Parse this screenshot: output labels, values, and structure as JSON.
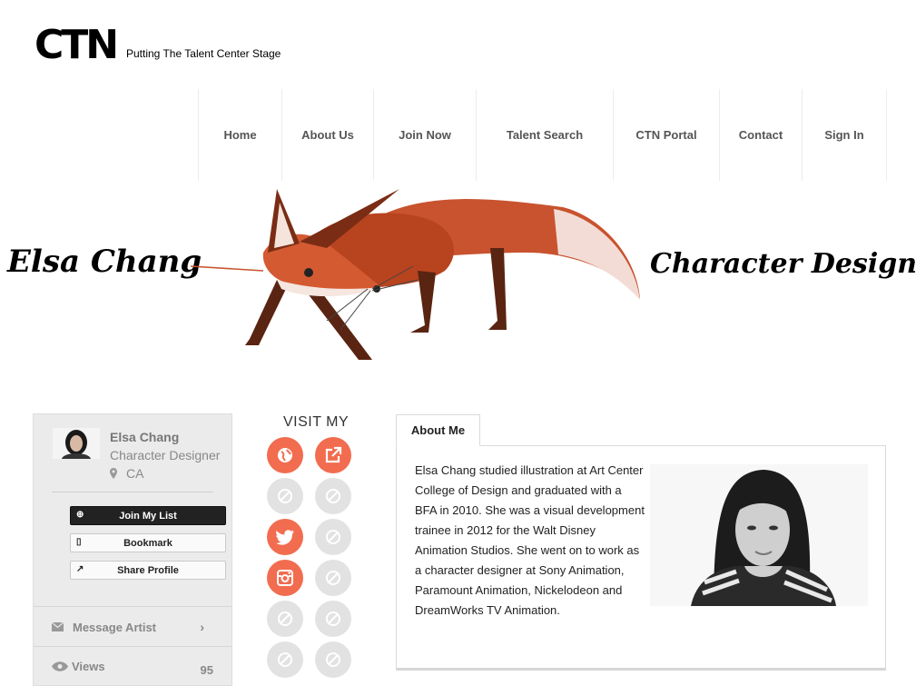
{
  "header": {
    "logo": "CTN",
    "tagline": "Putting The Talent Center Stage"
  },
  "nav": {
    "items": [
      {
        "label": "Home"
      },
      {
        "label": "About Us"
      },
      {
        "label": "Join Now"
      },
      {
        "label": "Talent Search"
      },
      {
        "label": "CTN Portal"
      },
      {
        "label": "Contact"
      },
      {
        "label": "Sign In"
      }
    ]
  },
  "banner": {
    "name": "Elsa Chang",
    "title": "Character Designer"
  },
  "profile": {
    "name": "Elsa Chang",
    "role": "Character Designer",
    "location": "CA",
    "buttons": {
      "join": "Join My List",
      "bookmark": "Bookmark",
      "share": "Share Profile"
    },
    "message": "Message Artist",
    "views_label": "Views",
    "views_count": "95"
  },
  "visit": {
    "title": "VISIT MY",
    "links": [
      {
        "icon": "globe-icon",
        "active": true
      },
      {
        "icon": "external-link-icon",
        "active": true
      },
      {
        "icon": "disabled-icon",
        "active": false
      },
      {
        "icon": "disabled-icon",
        "active": false
      },
      {
        "icon": "twitter-icon",
        "active": true
      },
      {
        "icon": "disabled-icon",
        "active": false
      },
      {
        "icon": "instagram-icon",
        "active": true
      },
      {
        "icon": "disabled-icon",
        "active": false
      },
      {
        "icon": "disabled-icon",
        "active": false
      },
      {
        "icon": "disabled-icon",
        "active": false
      },
      {
        "icon": "disabled-icon",
        "active": false
      },
      {
        "icon": "disabled-icon",
        "active": false
      }
    ]
  },
  "about": {
    "tab": "About Me",
    "bio": "Elsa Chang studied illustration at Art Center College of Design and graduated with a BFA in 2010. She was a visual development trainee in 2012 for the Walt Disney Animation Studios. She went on to work as a character designer at Sony Animation, Paramount Animation, Nickelodeon and DreamWorks TV Animation."
  },
  "colors": {
    "accent": "#f26c4f",
    "inactive": "#e2e2e2",
    "card_bg": "#ebebeb"
  }
}
